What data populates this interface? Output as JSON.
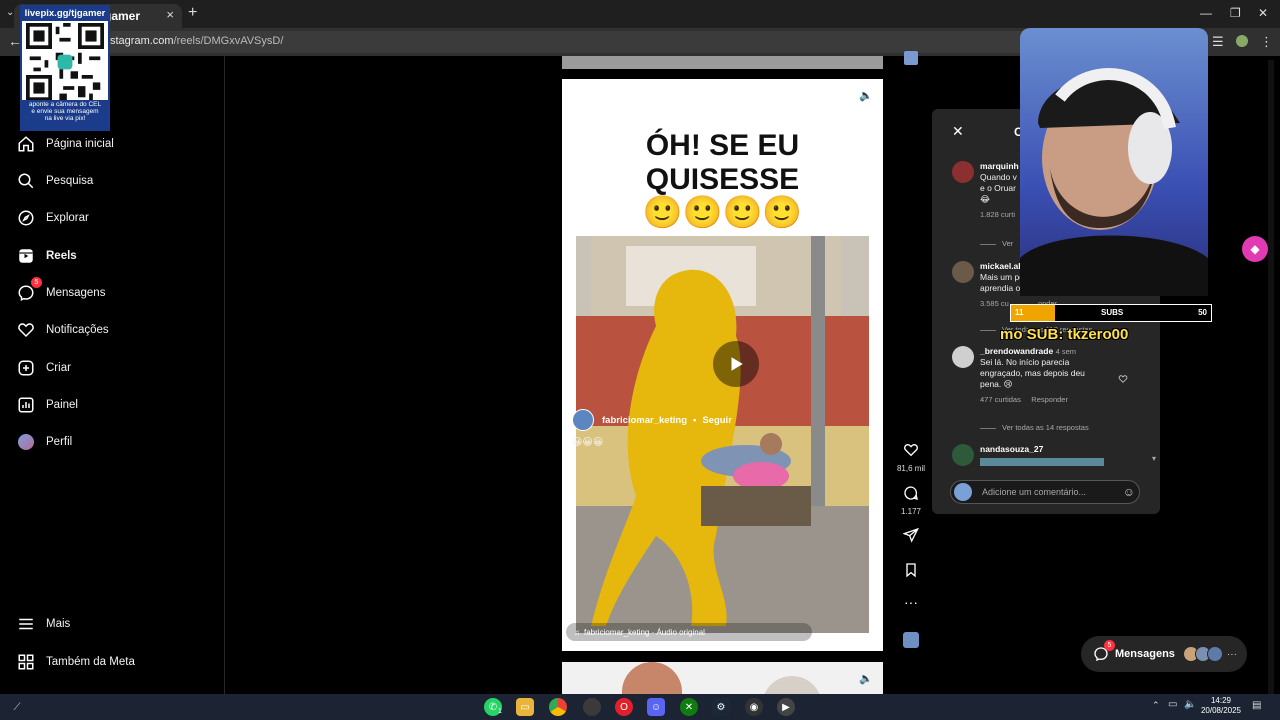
{
  "browser": {
    "tab_title": "livepix.gg/tjgamer",
    "tab_close": "×",
    "new_tab": "+",
    "url_host": "stagram.com",
    "url_path": "/reels/DMGxvAVSysD/",
    "window_controls": [
      "—",
      "❐",
      "✕"
    ]
  },
  "qr_overlay": {
    "header": "livepix.gg/tjgamer",
    "caption_lines": [
      "aponte a câmera do CEL",
      "e envie sua mensagem",
      "na live via pix!"
    ]
  },
  "sidebar": {
    "items": [
      {
        "label": "Página inicial",
        "icon": "home-icon"
      },
      {
        "label": "Pesquisa",
        "icon": "search-icon"
      },
      {
        "label": "Explorar",
        "icon": "compass-icon"
      },
      {
        "label": "Reels",
        "icon": "reels-icon",
        "active": true
      },
      {
        "label": "Mensagens",
        "icon": "messenger-icon",
        "badge": "5"
      },
      {
        "label": "Notificações",
        "icon": "heart-icon"
      },
      {
        "label": "Criar",
        "icon": "plus-square-icon"
      },
      {
        "label": "Painel",
        "icon": "dashboard-icon"
      },
      {
        "label": "Perfil",
        "icon": "profile-avatar"
      }
    ],
    "bottom": [
      {
        "label": "Mais",
        "icon": "menu-icon"
      },
      {
        "label": "Também da Meta",
        "icon": "meta-icon"
      }
    ]
  },
  "post": {
    "caption_line1": "ÓH! SE EU",
    "caption_line2": "QUISESSE",
    "caption_emojis": "🙂🙂🙂🙂",
    "author": "fabriciomar_keting",
    "follow": "Seguir",
    "separator": "•",
    "emoji_line": "😀😀😀",
    "audio": "fabriciomar_keting · Áudio original",
    "mute_icon": "speaker-icon"
  },
  "actions": {
    "likes": "81,6 mil",
    "comments": "1.177"
  },
  "comments": {
    "title": "C",
    "items": [
      {
        "user": "marquinh",
        "text_lines": [
          "Quando v",
          "e o Oruar"
        ],
        "emoji": "😂",
        "meta": "1.828 curti",
        "replies": "Ver"
      },
      {
        "user": "mickael.alve",
        "text_lines": [
          "Mais um pouquinho e",
          "aprendia o B"
        ],
        "meta": "3.585 cu",
        "reply": "onder",
        "replies": "Ver todas as 118 respostas"
      },
      {
        "user": "_brendowandrade",
        "time": "4 sem",
        "text_lines": [
          "Sei lá. No início parecia",
          "engraçado, mas depois deu",
          "pena. 😢"
        ],
        "meta": "477 curtidas",
        "reply": "Responder",
        "replies": "Ver todas as 14 respostas"
      },
      {
        "user": "nandasouza_27"
      }
    ],
    "input_placeholder": "Adicione um comentário..."
  },
  "stream": {
    "sub_left": "11",
    "sub_label": "SUBS",
    "sub_right": "50",
    "sub_progress": 0.22,
    "ticker": "mo SUB: tkzero00"
  },
  "messages_bar": {
    "label": "Mensagens",
    "badge": "5",
    "more": "···"
  },
  "taskbar": {
    "time": "14:29",
    "date": "20/08/2025",
    "whatsapp_badge": "1"
  }
}
